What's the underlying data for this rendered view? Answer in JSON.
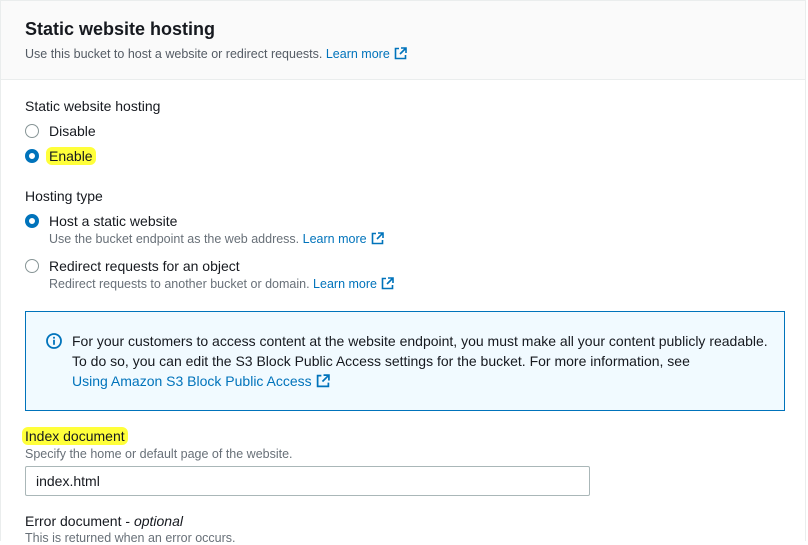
{
  "section": {
    "title": "Static website hosting",
    "description": "Use this bucket to host a website or redirect requests.",
    "learn_more": "Learn more"
  },
  "hosting": {
    "label": "Static website hosting",
    "options": [
      {
        "label": "Disable",
        "selected": false
      },
      {
        "label": "Enable",
        "selected": true
      }
    ]
  },
  "hosting_type": {
    "label": "Hosting type",
    "options": [
      {
        "label": "Host a static website",
        "description": "Use the bucket endpoint as the web address.",
        "learn_more": "Learn more",
        "selected": true
      },
      {
        "label": "Redirect requests for an object",
        "description": "Redirect requests to another bucket or domain.",
        "learn_more": "Learn more",
        "selected": false
      }
    ]
  },
  "info_alert": {
    "text": "For your customers to access content at the website endpoint, you must make all your content publicly readable. To do so, you can edit the S3 Block Public Access settings for the bucket. For more information, see",
    "link": "Using Amazon S3 Block Public Access"
  },
  "index_document": {
    "label": "Index document",
    "description": "Specify the home or default page of the website.",
    "value": "index.html"
  },
  "error_document": {
    "label": "Error document - ",
    "optional": "optional",
    "description": "This is returned when an error occurs."
  },
  "colors": {
    "accent": "#0073bb",
    "highlight": "#ffff3a"
  }
}
